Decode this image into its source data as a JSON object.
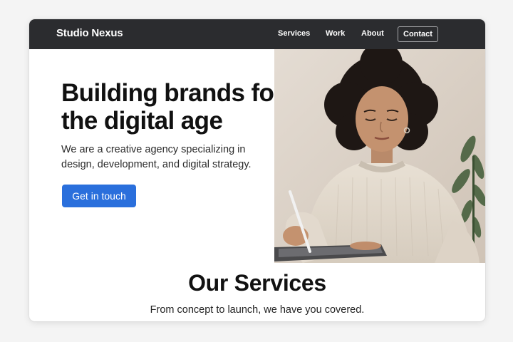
{
  "header": {
    "brand": "Studio Nexus",
    "nav": {
      "services": "Services",
      "work": "Work",
      "about": "About",
      "contact": "Contact"
    }
  },
  "hero": {
    "title": "Building brands for the digital age",
    "subtitle": "We are a creative agency specializing in design, development, and digital strategy.",
    "cta_label": "Get in touch",
    "image": "woman-sketching-on-tablet-photo"
  },
  "services": {
    "heading": "Our Services",
    "subtitle": "From concept to launch, we have you covered."
  },
  "colors": {
    "nav_background": "#2b2c2f",
    "accent": "#2a6fdc",
    "text_dark": "#111111",
    "page_background": "#f4f4f4"
  }
}
